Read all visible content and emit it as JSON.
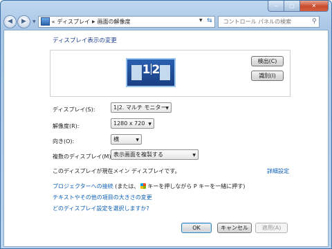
{
  "window": {
    "breadcrumb": [
      "ディスプレイ",
      "画面の解像度"
    ],
    "search_placeholder": "コントロール パネルの検索",
    "controls": {
      "minimize": "‒",
      "maximize": "□",
      "close": "✕"
    },
    "overflow_glyph": "«"
  },
  "main": {
    "heading": "ディスプレイ表示の変更",
    "detect_button": "検出(C)",
    "identify_button": "識別(I)",
    "monitor_label_left": "1",
    "monitor_label_right": "2",
    "display_label": "ディスプレイ(S):",
    "display_value": "1|2. マルチ モニター",
    "resolution_label": "解像度(R):",
    "resolution_value": "1280 x 720",
    "orientation_label": "向き(O):",
    "orientation_value": "横",
    "multi_label": "複数のディスプレイ(M):",
    "multi_value": "表示画面を複製する",
    "main_display_text": "このディスプレイが現在メイン ディスプレイです。",
    "advanced_link": "詳細設定",
    "projector_link": "プロジェクターへの接続",
    "projector_text_before": " (または、",
    "projector_text_after": "キーを押しながら P キーを一緒に押す)",
    "text_size_link": "テキストやその他の項目の大きさの変更",
    "which_settings_link": "どのディスプレイ設定を選択しますか?"
  },
  "footer": {
    "ok": "OK",
    "cancel": "キャンセル",
    "apply": "適用(A)"
  },
  "colors": {
    "link": "#0b5fb6",
    "heading": "#1f3f8f",
    "monitor": "#1a3f82"
  }
}
